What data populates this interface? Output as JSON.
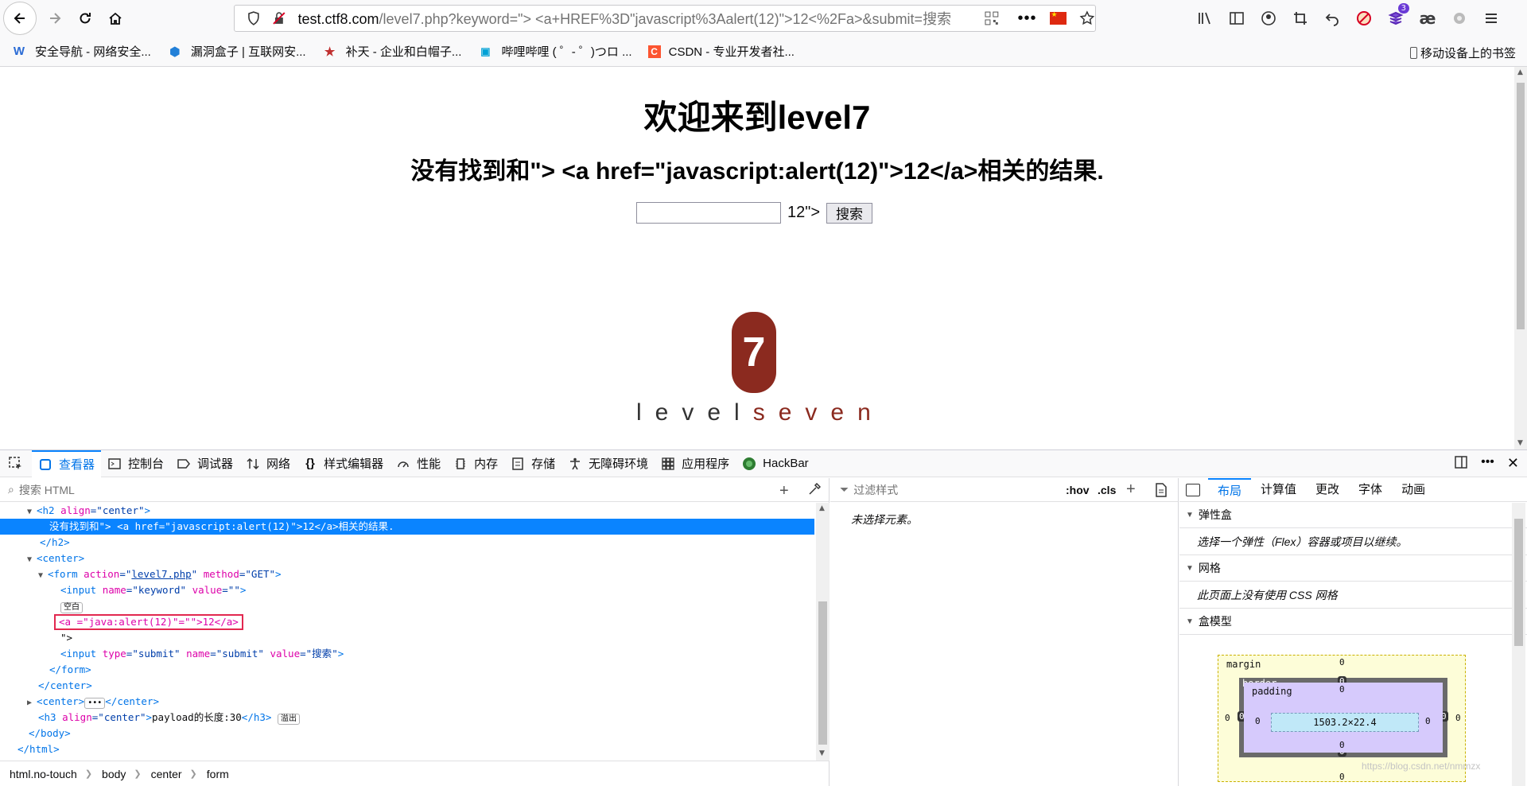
{
  "browser": {
    "url_host": "test.ctf8.com",
    "url_path": "/level7.php?keyword=\"> <a+HREF%3D\"javascript%3Aalert(12)\">12<%2Fa>&submit=搜索",
    "extension_badge": "3",
    "ae_label": "æ"
  },
  "bookmarks": [
    {
      "icon": "W",
      "label": "安全导航 - 网络安全..."
    },
    {
      "icon": "⬢",
      "label": "漏洞盒子 | 互联网安..."
    },
    {
      "icon": "★",
      "label": "补天 - 企业和白帽子..."
    },
    {
      "icon": "📺",
      "label": "哔哩哔哩 ( ゜- ゜)つロ ..."
    },
    {
      "icon": "C",
      "label": "CSDN - 专业开发者社..."
    }
  ],
  "bookmarks_mobile": "移动设备上的书签",
  "page": {
    "title": "欢迎来到level7",
    "result_text": "没有找到和\"> <a href=\"javascript:alert(12)\">12</a>相关的结果.",
    "input_value": "",
    "leftover_text": "12\">",
    "submit_label": "搜索",
    "logo_digit": "7",
    "logo_word_a": "level",
    "logo_word_b": "seven"
  },
  "devtools": {
    "tabs": [
      "查看器",
      "控制台",
      "调试器",
      "网络",
      "样式编辑器",
      "性能",
      "内存",
      "存储",
      "无障碍环境",
      "应用程序",
      "HackBar"
    ],
    "search_placeholder": "搜索 HTML",
    "tree": {
      "h2_open_tag": "h2",
      "h2_attr": "align",
      "h2_val": "center",
      "selected_text": "没有找到和\"> <a href=\"javascript:alert(12)\">12</a>相关的结果.",
      "h2_close": "</h2>",
      "center_open": "<center>",
      "form_attr1": "action",
      "form_val1": "level7.php",
      "form_attr2": "method",
      "form_val2": "GET",
      "input_attr1": "name",
      "input_val1": "keyword",
      "input_attr2": "value",
      "input_val2": "",
      "whitespace_pill": "空白",
      "a_line": "<a =\"java:alert(12)\"=\"\">12</a>",
      "quote_line": "\">",
      "submit_attr1": "type",
      "submit_val1": "submit",
      "submit_attr2": "name",
      "submit_val2": "submit",
      "submit_attr3": "value",
      "submit_val3": "搜索",
      "form_close": "</form>",
      "center_close": "</center>",
      "center_collapsed": "<center>",
      "center_collapsed_close": "</center>",
      "h3_attr": "align",
      "h3_val": "center",
      "h3_text": "payload的长度:30",
      "h3_close": "</h3>",
      "overflow_pill": "溢出",
      "body_close": "</body>",
      "html_close": "</html>"
    },
    "breadcrumbs": [
      "html.no-touch",
      "body",
      "center",
      "form"
    ],
    "filter_placeholder": "过滤样式",
    "hov": ":hov",
    "cls": ".cls",
    "no_element": "未选择元素。",
    "right_tabs": [
      "布局",
      "计算值",
      "更改",
      "字体",
      "动画"
    ],
    "sections": [
      {
        "title": "弹性盒",
        "body": "选择一个弹性（Flex）容器或项目以继续。"
      },
      {
        "title": "网格",
        "body": "此页面上没有使用 CSS 网格"
      },
      {
        "title": "盒模型",
        "body": ""
      }
    ],
    "box_model": {
      "margin_label": "margin",
      "border_label": "border",
      "padding_label": "padding",
      "content_size": "1503.2×22.4",
      "zero": "0"
    }
  },
  "watermark": "https://blog.csdn.net/nmmzx"
}
